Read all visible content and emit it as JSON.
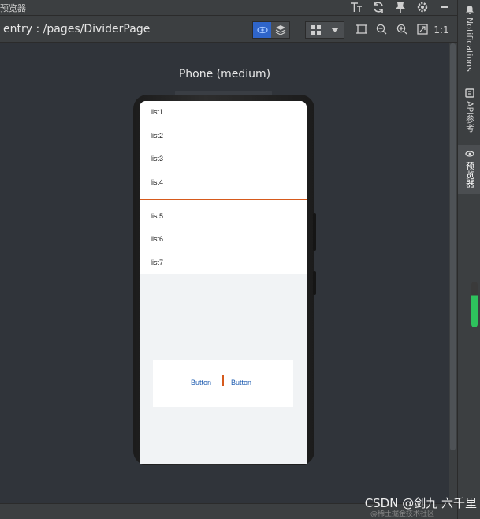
{
  "panel": {
    "title": "预览器"
  },
  "toolbar": {
    "path": "entry : /pages/DividerPage",
    "zoom_actual": "1:1"
  },
  "device": {
    "name": "Phone (medium)"
  },
  "screen": {
    "list": [
      "list1",
      "list2",
      "list3",
      "list4",
      "list5",
      "list6",
      "list7"
    ],
    "buttons": [
      "Button",
      "Button"
    ]
  },
  "sidebar": {
    "tabs": [
      "Notifications",
      "API参考",
      "预览器"
    ]
  },
  "watermark": {
    "text": "CSDN @剑九 六千里",
    "sub": "@稀土掘金技术社区"
  },
  "colors": {
    "accent": "#2f65ca",
    "divider": "#d65a1d",
    "button_text": "#1e5cb0",
    "indicator": "#2ec25d"
  }
}
